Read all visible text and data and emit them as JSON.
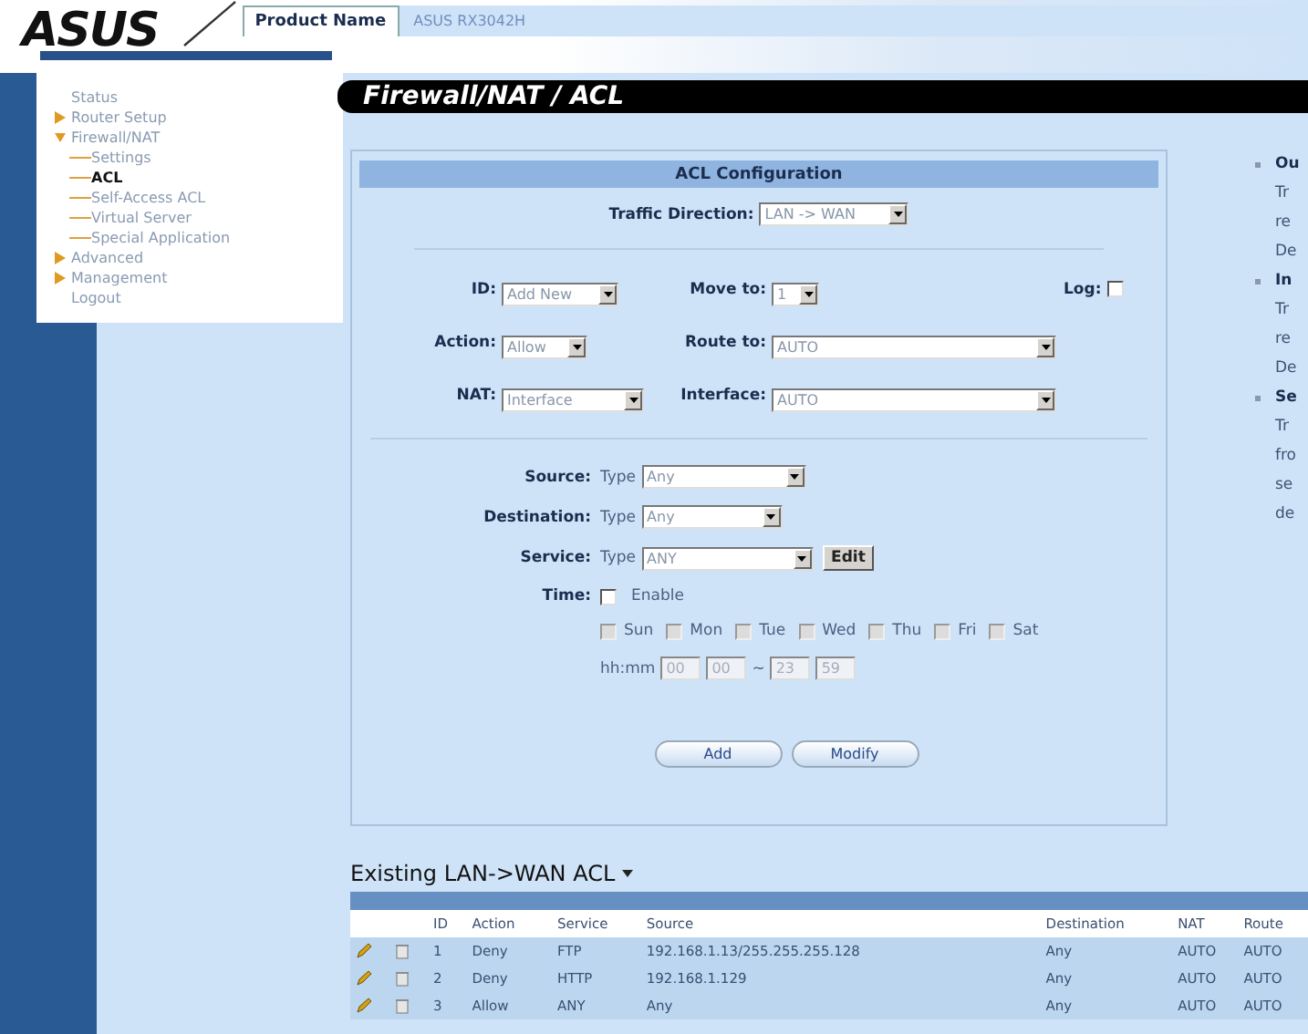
{
  "header": {
    "logo": "ASUS",
    "product_label": "Product Name",
    "product_value": "ASUS RX3042H"
  },
  "sidebar": {
    "items": [
      {
        "label": "Status",
        "kind": "link",
        "selected": false
      },
      {
        "label": "Router Setup",
        "kind": "folder",
        "expanded": false,
        "selected": false
      },
      {
        "label": "Firewall/NAT",
        "kind": "folder",
        "expanded": true,
        "selected": false,
        "children": [
          {
            "label": "Settings",
            "kind": "link",
            "selected": false
          },
          {
            "label": "ACL",
            "kind": "link",
            "selected": true
          },
          {
            "label": "Self-Access ACL",
            "kind": "link",
            "selected": false
          },
          {
            "label": "Virtual Server",
            "kind": "link",
            "selected": false
          },
          {
            "label": "Special Application",
            "kind": "link",
            "selected": false
          }
        ]
      },
      {
        "label": "Advanced",
        "kind": "folder",
        "expanded": false,
        "selected": false
      },
      {
        "label": "Management",
        "kind": "folder",
        "expanded": false,
        "selected": false
      },
      {
        "label": "Logout",
        "kind": "link",
        "selected": false
      }
    ]
  },
  "page_title": "Firewall/NAT / ACL",
  "acl_config": {
    "title": "ACL Configuration",
    "traffic_direction": {
      "label": "Traffic Direction:",
      "value": "LAN -> WAN"
    },
    "id": {
      "label": "ID:",
      "value": "Add New"
    },
    "move_to": {
      "label": "Move to:",
      "value": "1"
    },
    "log": {
      "label": "Log:",
      "checked": false
    },
    "action": {
      "label": "Action:",
      "value": "Allow"
    },
    "route_to": {
      "label": "Route to:",
      "value": "AUTO"
    },
    "nat": {
      "label": "NAT:",
      "value": "Interface"
    },
    "interface": {
      "label": "Interface:",
      "value": "AUTO"
    },
    "source": {
      "label": "Source:",
      "type_label": "Type",
      "value": "Any"
    },
    "destination": {
      "label": "Destination:",
      "type_label": "Type",
      "value": "Any"
    },
    "service": {
      "label": "Service:",
      "type_label": "Type",
      "value": "ANY",
      "button": "Edit"
    },
    "time": {
      "label": "Time:",
      "enable": {
        "label": "Enable",
        "checked": false
      },
      "days": [
        {
          "label": "Sun",
          "checked": false,
          "disabled": true
        },
        {
          "label": "Mon",
          "checked": false,
          "disabled": true
        },
        {
          "label": "Tue",
          "checked": false,
          "disabled": true
        },
        {
          "label": "Wed",
          "checked": false,
          "disabled": true
        },
        {
          "label": "Thu",
          "checked": false,
          "disabled": true
        },
        {
          "label": "Fri",
          "checked": false,
          "disabled": true
        },
        {
          "label": "Sat",
          "checked": false,
          "disabled": true
        }
      ],
      "hhmm_label": "hh:mm",
      "start": [
        {
          "value": "00",
          "disabled": true
        },
        {
          "value": "00",
          "disabled": true
        }
      ],
      "range_separator": "~",
      "end": [
        {
          "value": "23",
          "disabled": true
        },
        {
          "value": "59",
          "disabled": true
        }
      ]
    },
    "buttons": [
      "Add",
      "Modify"
    ]
  },
  "help": [
    {
      "title": "Ou",
      "lines": [
        "Tr",
        "re",
        "De"
      ]
    },
    {
      "title": "In",
      "lines": [
        "Tr",
        "re",
        "De"
      ]
    },
    {
      "title": "Se",
      "lines": [
        "Tr",
        "fro",
        "se",
        "de"
      ]
    }
  ],
  "table": {
    "title": "Existing LAN->WAN ACL",
    "columns": [
      "ID",
      "Action",
      "Service",
      "Source",
      "Destination",
      "NAT",
      "Route"
    ],
    "rows": [
      {
        "id": "1",
        "action": "Deny",
        "service": "FTP",
        "source": "192.168.1.13/255.255.255.128",
        "destination": "Any",
        "nat": "AUTO",
        "route": "AUTO"
      },
      {
        "id": "2",
        "action": "Deny",
        "service": "HTTP",
        "source": "192.168.1.129",
        "destination": "Any",
        "nat": "AUTO",
        "route": "AUTO"
      },
      {
        "id": "3",
        "action": "Allow",
        "service": "ANY",
        "source": "Any",
        "destination": "Any",
        "nat": "AUTO",
        "route": "AUTO"
      }
    ]
  }
}
